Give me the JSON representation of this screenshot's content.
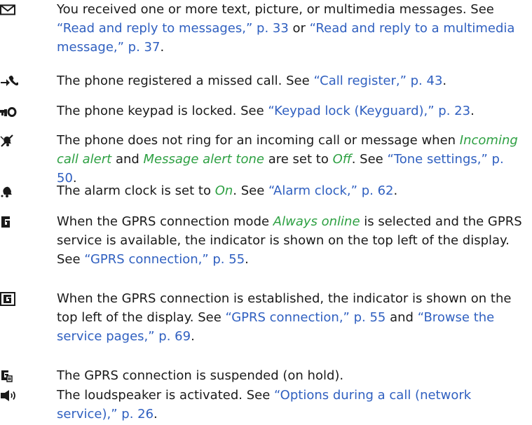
{
  "colors": {
    "text": "#1a1a1a",
    "link": "#3060c0",
    "italic_green": "#2ea043"
  },
  "entries": [
    {
      "icon": "envelope-icon",
      "segments": [
        {
          "type": "text",
          "text": "You received one or more text, picture, or multimedia messages. See "
        },
        {
          "type": "link",
          "text": "“Read and reply to messages,” p. 33"
        },
        {
          "type": "text",
          "text": " or "
        },
        {
          "type": "link",
          "text": "“Read and reply to a multimedia message,” p. 37"
        },
        {
          "type": "text",
          "text": "."
        }
      ]
    },
    {
      "icon": "missed-call-icon",
      "segments": [
        {
          "type": "text",
          "text": "The phone registered a missed call. See "
        },
        {
          "type": "link",
          "text": "“Call register,” p. 43"
        },
        {
          "type": "text",
          "text": "."
        }
      ]
    },
    {
      "icon": "keypad-lock-icon",
      "segments": [
        {
          "type": "text",
          "text": "The phone keypad is locked. See "
        },
        {
          "type": "link",
          "text": "“Keypad lock (Keyguard),” p. 23"
        },
        {
          "type": "text",
          "text": "."
        }
      ]
    },
    {
      "icon": "silent-bell-icon",
      "segments": [
        {
          "type": "text",
          "text": "The phone does not ring for an incoming call or message when "
        },
        {
          "type": "italic",
          "text": "Incoming call alert"
        },
        {
          "type": "text",
          "text": " and "
        },
        {
          "type": "italic",
          "text": "Message alert tone"
        },
        {
          "type": "text",
          "text": " are set to "
        },
        {
          "type": "italic",
          "text": "Off"
        },
        {
          "type": "text",
          "text": ". See "
        },
        {
          "type": "link",
          "text": "“Tone settings,” p. 50"
        },
        {
          "type": "text",
          "text": "."
        }
      ]
    },
    {
      "icon": "alarm-bell-icon",
      "segments": [
        {
          "type": "text",
          "text": "The alarm clock is set to "
        },
        {
          "type": "italic",
          "text": "On"
        },
        {
          "type": "text",
          "text": ". See "
        },
        {
          "type": "link",
          "text": "“Alarm clock,” p. 62"
        },
        {
          "type": "text",
          "text": "."
        }
      ]
    },
    {
      "icon": "gprs-available-icon",
      "segments": [
        {
          "type": "text",
          "text": "When the GPRS connection mode "
        },
        {
          "type": "italic",
          "text": "Always online"
        },
        {
          "type": "text",
          "text": " is selected and the GPRS service is available, the indicator is shown on the top left of the display. See "
        },
        {
          "type": "link",
          "text": "“GPRS connection,” p. 55"
        },
        {
          "type": "text",
          "text": "."
        }
      ]
    },
    {
      "icon": "gprs-connected-icon",
      "segments": [
        {
          "type": "text",
          "text": "When the GPRS connection is established, the indicator is shown on the top left of the display. See "
        },
        {
          "type": "link",
          "text": "“GPRS connection,” p. 55"
        },
        {
          "type": "text",
          "text": " and "
        },
        {
          "type": "link",
          "text": "“Browse the service pages,” p. 69"
        },
        {
          "type": "text",
          "text": "."
        }
      ]
    },
    {
      "icon": "gprs-suspended-icon",
      "segments": [
        {
          "type": "text",
          "text": "The GPRS connection is suspended (on hold)."
        }
      ]
    },
    {
      "icon": "loudspeaker-icon",
      "segments": [
        {
          "type": "text",
          "text": "The loudspeaker is activated. See "
        },
        {
          "type": "link",
          "text": "“Options during a call (network service),” p. 26"
        },
        {
          "type": "text",
          "text": "."
        }
      ]
    }
  ]
}
